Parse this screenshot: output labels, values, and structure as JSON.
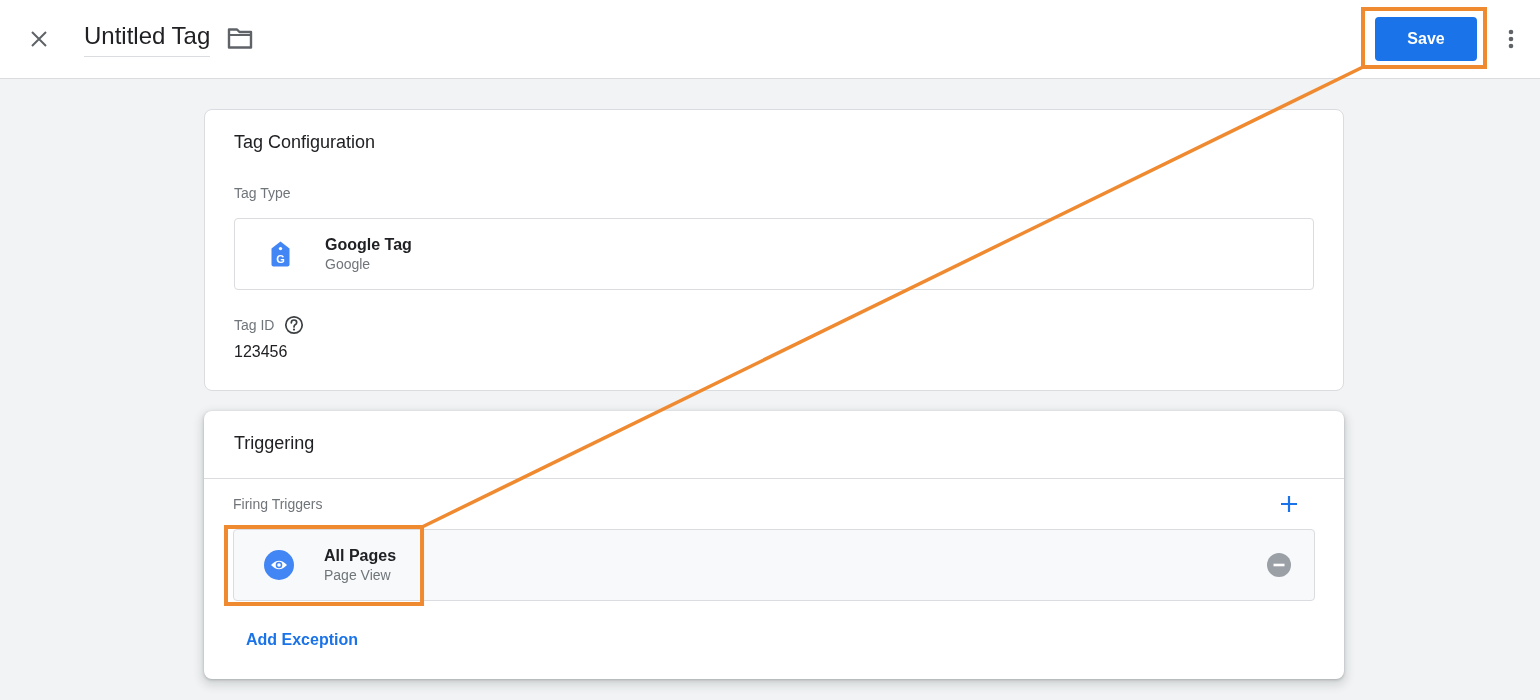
{
  "header": {
    "title": "Untitled Tag",
    "save_button": {
      "label": "Save",
      "highlighted": true
    }
  },
  "tag_configuration": {
    "title": "Tag Configuration",
    "tag_type": {
      "label": "Tag Type",
      "icon_text": "G",
      "name": "Google Tag",
      "vendor": "Google"
    },
    "tag_id": {
      "label": "Tag ID",
      "value": "123456"
    }
  },
  "triggering": {
    "title": "Triggering",
    "firing_triggers": {
      "label": "Firing Triggers",
      "items": [
        {
          "name": "All Pages",
          "type": "Page View",
          "highlighted": true
        }
      ]
    },
    "exception_link": "Add Exception"
  }
}
